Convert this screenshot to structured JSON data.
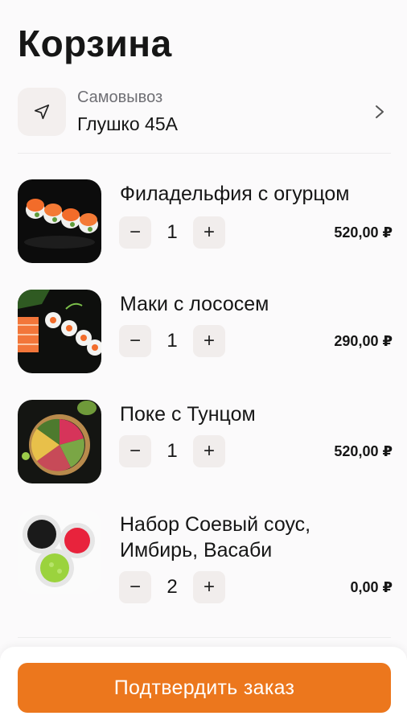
{
  "header": {
    "title": "Корзина"
  },
  "pickup": {
    "label": "Самовывоз",
    "address": "Глушко 45А",
    "icon": "navigation-arrow-icon"
  },
  "items": [
    {
      "name": "Филадельфия с огурцом",
      "quantity": "1",
      "price": "520,00 ₽",
      "image": "philadelphia-roll-image"
    },
    {
      "name": "Маки с лососем",
      "quantity": "1",
      "price": "290,00 ₽",
      "image": "maki-salmon-image"
    },
    {
      "name": "Поке с Тунцом",
      "quantity": "1",
      "price": "520,00 ₽",
      "image": "poke-tuna-image"
    },
    {
      "name": "Набор Соевый соус, Имбирь, Васаби",
      "quantity": "2",
      "price": "0,00 ₽",
      "image": "soy-ginger-wasabi-image"
    }
  ],
  "controls": {
    "minus": "−",
    "plus": "+"
  },
  "footer": {
    "confirm_label": "Подтвердить заказ"
  },
  "colors": {
    "accent": "#ec771d",
    "step_bg": "#f1edec",
    "background": "#fbfafb"
  }
}
